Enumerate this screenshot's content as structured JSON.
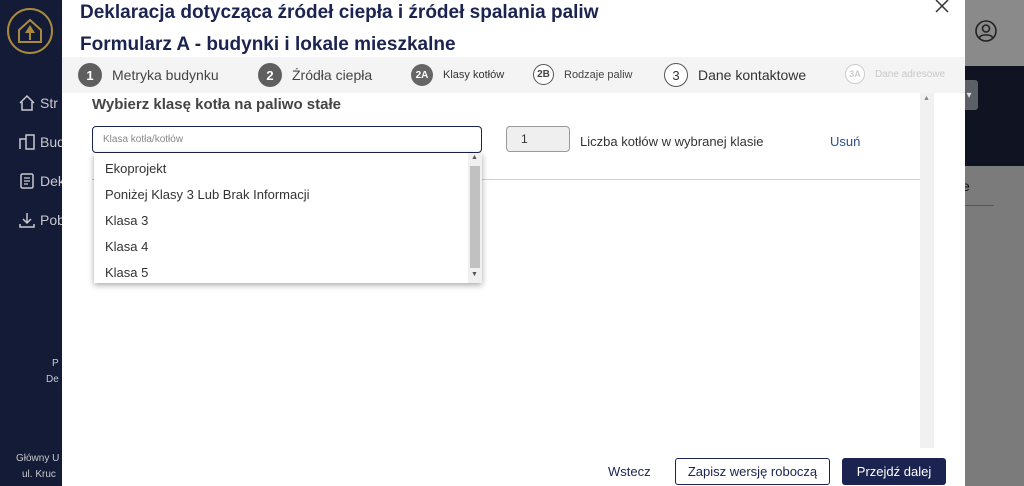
{
  "background": {
    "sidebar": {
      "items": [
        {
          "icon": "home-icon",
          "label": "Str"
        },
        {
          "icon": "building-icon",
          "label": "Bud"
        },
        {
          "icon": "document-icon",
          "label": "Dek"
        },
        {
          "icon": "download-icon",
          "label": "Pob"
        }
      ],
      "footer_lines": [
        "P",
        "De",
        "Główny U",
        "ul. Kruc"
      ]
    },
    "right_text": "e"
  },
  "modal": {
    "title": "Deklaracja dotycząca źródeł ciepła i źródeł spalania paliw",
    "subtitle": "Formularz A - budynki i lokale mieszkalne",
    "steps": [
      {
        "num": "1",
        "label": "Metryka budynku"
      },
      {
        "num": "2",
        "label": "Źródła ciepła"
      },
      {
        "num": "2A",
        "label": "Klasy kotłów"
      },
      {
        "num": "2B",
        "label": "Rodzaje paliw"
      },
      {
        "num": "3",
        "label": "Dane kontaktowe"
      },
      {
        "num": "3A",
        "label": "Dane adresowe"
      }
    ],
    "section_title": "Wybierz klasę kotła na paliwo stałe",
    "class_input_placeholder": "Klasa kotła/kotłów",
    "count_value": "1",
    "count_label": "Liczba kotłów w wybranej klasie",
    "remove_label": "Usuń",
    "dropdown_options": [
      "Ekoprojekt",
      "Poniżej Klasy 3 Lub Brak Informacji",
      "Klasa 3",
      "Klasa 4",
      "Klasa 5"
    ],
    "footer": {
      "back": "Wstecz",
      "save_draft": "Zapisz wersję roboczą",
      "next": "Przejdź dalej"
    }
  }
}
